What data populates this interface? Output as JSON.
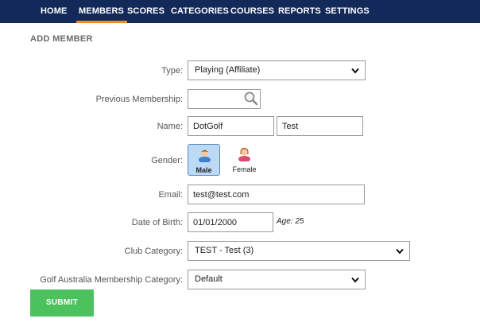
{
  "nav": {
    "items": [
      {
        "label": "HOME"
      },
      {
        "label": "MEMBERS"
      },
      {
        "label": "SCORES"
      },
      {
        "label": "CATEGORIES"
      },
      {
        "label": "COURSES"
      },
      {
        "label": "REPORTS"
      },
      {
        "label": "SETTINGS"
      }
    ],
    "active": "MEMBERS",
    "accent_color": "#f08a24",
    "background_color": "#13295a"
  },
  "page": {
    "title": "ADD MEMBER"
  },
  "form": {
    "type": {
      "label": "Type:",
      "value": "Playing (Affiliate)"
    },
    "previous_membership": {
      "label": "Previous Membership:",
      "value": "",
      "icon": "search-icon"
    },
    "name": {
      "label": "Name:",
      "first": "DotGolf",
      "last": "Test"
    },
    "gender": {
      "label": "Gender:",
      "selected": "Male",
      "options": [
        {
          "label": "Male",
          "icon": "male-user-icon"
        },
        {
          "label": "Female",
          "icon": "female-user-icon"
        }
      ]
    },
    "email": {
      "label": "Email:",
      "value": "test@test.com"
    },
    "dob": {
      "label": "Date of Birth:",
      "value": "01/01/2000",
      "age": "Age: 25"
    },
    "club_category": {
      "label": "Club Category:",
      "value": "TEST - Test (3)"
    },
    "ga_category": {
      "label": "Golf Australia Membership Category:",
      "value": "Default"
    },
    "submit": {
      "label": "SUBMIT",
      "color": "#4cc25f"
    }
  }
}
